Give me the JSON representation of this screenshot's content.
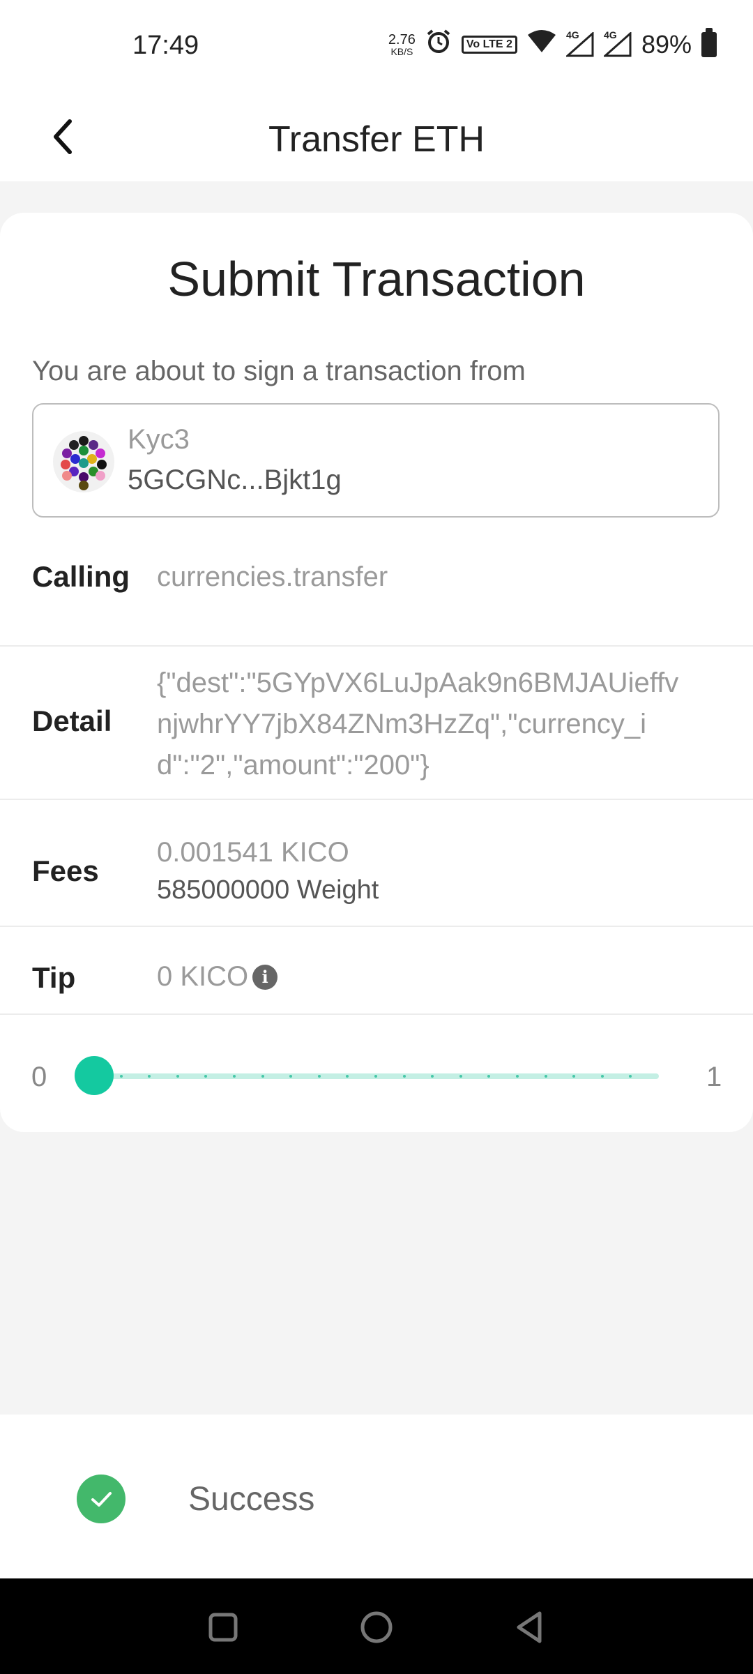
{
  "status_bar": {
    "time": "17:49",
    "net_speed_value": "2.76",
    "net_speed_unit": "KB/S",
    "volte": "Vo LTE 2",
    "network_1": "4G",
    "network_2": "4G",
    "battery": "89%",
    "icons": [
      "alarm-icon",
      "volte-icon",
      "wifi-icon",
      "signal-icon",
      "signal-icon",
      "battery-icon"
    ]
  },
  "header": {
    "title": "Transfer ETH",
    "back_icon": "chevron-left-icon"
  },
  "card": {
    "title": "Submit Transaction",
    "sign_note": "You are about to sign a transaction from",
    "account": {
      "name": "Kyc3",
      "address": "5GCGNc...Bjkt1g"
    },
    "calling": {
      "label": "Calling",
      "value": "currencies.transfer"
    },
    "detail": {
      "label": "Detail",
      "value": "{\"dest\":\"5GYpVX6LuJpAak9n6BMJAUieffvnjwhrYY7jbX84ZNm3HzZq\",\"currency_id\":\"2\",\"amount\":\"200\"}"
    },
    "fees": {
      "label": "Fees",
      "value": "0.001541 KICO",
      "weight": "585000000 Weight"
    },
    "tip": {
      "label": "Tip",
      "value": "0 KICO",
      "icon": "info-icon"
    },
    "slider": {
      "min_label": "0",
      "max_label": "1",
      "value": 0,
      "accent": "#14c9a0",
      "track": "#c4efe4"
    }
  },
  "result": {
    "text": "Success",
    "icon": "check-circle-icon",
    "color": "#43b86b"
  },
  "nav_bar": {
    "buttons": [
      "recents-square-icon",
      "home-circle-icon",
      "back-triangle-icon"
    ]
  }
}
